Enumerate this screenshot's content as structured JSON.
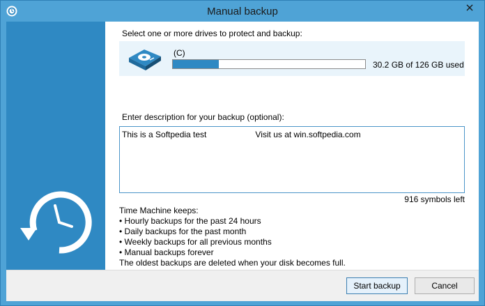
{
  "window": {
    "title": "Manual backup",
    "icons": {
      "app": "refresh-icon",
      "close": "close-icon",
      "sidebar": "time-machine-icon",
      "drive": "hard-drive-icon"
    }
  },
  "drives": {
    "label": "Select one or more drives to protect and backup:",
    "items": [
      {
        "name": "(C)",
        "usage": "30.2 GB of 126 GB used",
        "used_fraction": 0.24
      }
    ]
  },
  "description": {
    "label": "Enter description for your backup (optional):",
    "value": "This is a Softpedia test                     Visit us at win.softpedia.com",
    "symbols_left": "916 symbols left"
  },
  "info": {
    "heading": "Time Machine keeps:",
    "items": [
      "• Hourly backups for the past 24 hours",
      "• Daily backups for the past month",
      "• Weekly backups for all previous months",
      "• Manual backups forever"
    ],
    "footer": "The oldest backups are deleted when your disk becomes full."
  },
  "buttons": {
    "start": "Start backup",
    "cancel": "Cancel"
  },
  "colors": {
    "accent": "#2f89c3",
    "title_bar": "#4fa3d6",
    "drive_row": "#e9f4fb"
  }
}
